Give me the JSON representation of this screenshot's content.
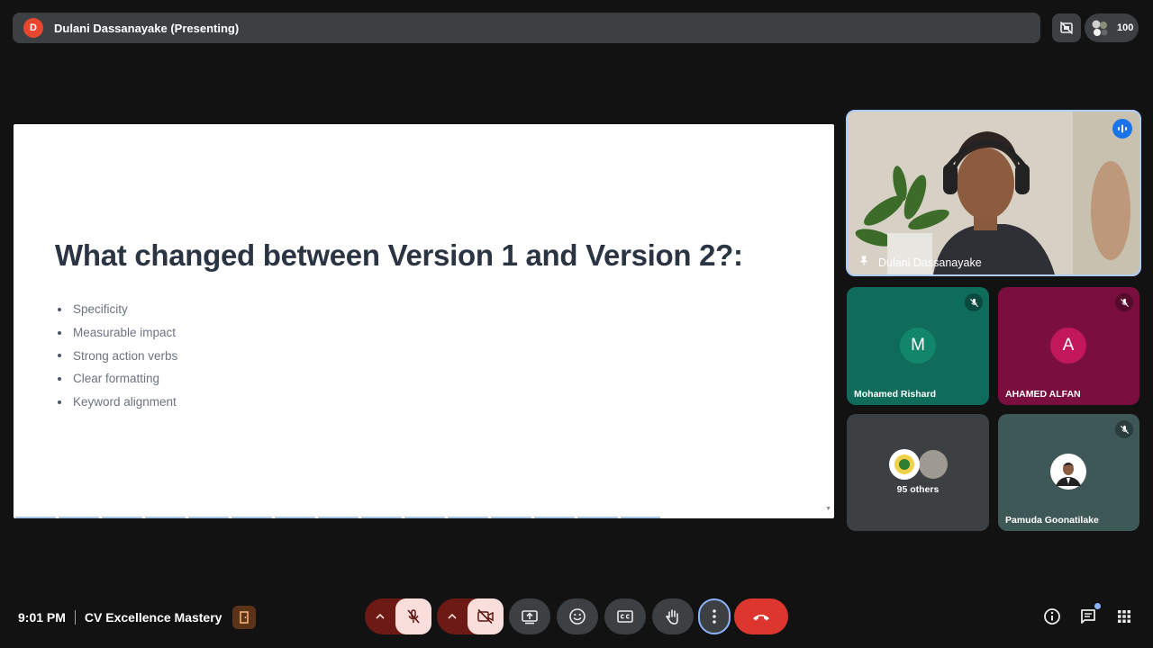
{
  "topbar": {
    "presenter_initial": "D",
    "presenter_label": "Dulani Dassanayake (Presenting)",
    "participant_count": "100"
  },
  "slide": {
    "title": "What changed between Version 1 and Version 2?:",
    "bullets": [
      "Specificity",
      "Measurable impact",
      "Strong action verbs",
      "Clear formatting",
      "Keyword alignment"
    ]
  },
  "tiles": {
    "speaker": {
      "name": "Dulani Dassanayake"
    },
    "p1": {
      "initial": "M",
      "name": "Mohamed Rishard",
      "bg": "#0f6b5a",
      "avatar_bg": "#12866b"
    },
    "p2": {
      "initial": "A",
      "name": "AHAMED ALFAN",
      "bg": "#7a0f3f",
      "avatar_bg": "#c2185b"
    },
    "others": {
      "label": "95 others"
    },
    "p3": {
      "name": "Pamuda Goonatilake",
      "bg": "#3d5856"
    }
  },
  "footer": {
    "time": "9:01 PM",
    "meeting_name": "CV Excellence Mastery"
  },
  "colors": {
    "end_call": "#dc362e",
    "accent_blue": "#8ab4f8",
    "muted_red": "#f9dedc"
  }
}
